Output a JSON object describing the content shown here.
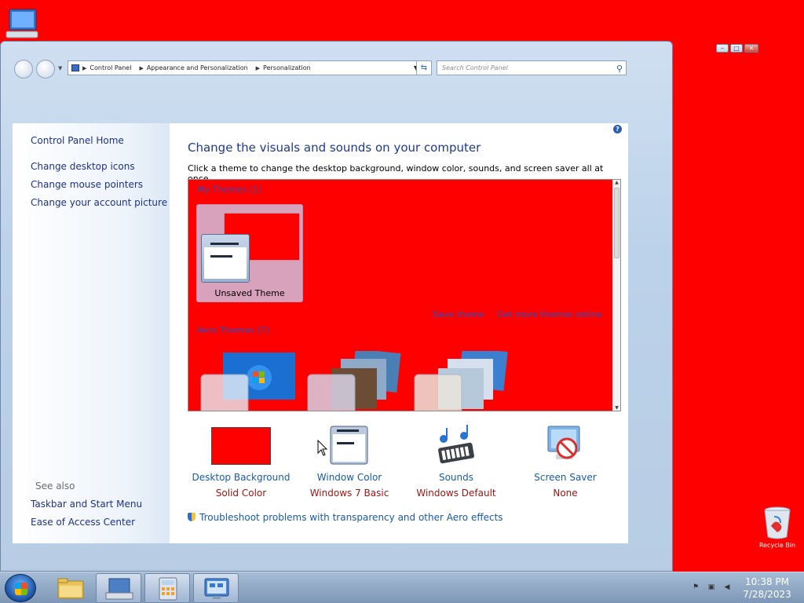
{
  "desktop": {
    "recycle_bin_label": "Recycle Bin"
  },
  "window": {
    "address": {
      "crumbs": [
        "Control Panel",
        "Appearance and Personalization",
        "Personalization"
      ]
    },
    "search_placeholder": "Search Control Panel",
    "caption": {
      "minimize": "–",
      "maximize": "□",
      "close": "✕"
    }
  },
  "sidebar": {
    "home": "Control Panel Home",
    "links": [
      "Change desktop icons",
      "Change mouse pointers",
      "Change your account picture"
    ],
    "see_also": "See also",
    "see_also_links": [
      "Taskbar and Start Menu",
      "Ease of Access Center"
    ]
  },
  "main": {
    "title": "Change the visuals and sounds on your computer",
    "subtitle": "Click a theme to change the desktop background, window color, sounds, and screen saver all at once.",
    "themes": {
      "my_themes_label": "My Themes (1)",
      "unsaved_theme": "Unsaved Theme",
      "save_theme": "Save theme",
      "get_more": "Get more themes online",
      "aero_label": "Aero Themes (7)"
    },
    "settings": [
      {
        "name": "Desktop Background",
        "value": "Solid Color",
        "icon": "desktop-background-icon"
      },
      {
        "name": "Window Color",
        "value": "Windows 7 Basic",
        "icon": "window-color-icon"
      },
      {
        "name": "Sounds",
        "value": "Windows Default",
        "icon": "sounds-icon"
      },
      {
        "name": "Screen Saver",
        "value": "None",
        "icon": "screen-saver-icon"
      }
    ],
    "troubleshoot": "Troubleshoot problems with transparency and other Aero effects"
  },
  "taskbar": {
    "time": "10:38 PM",
    "date": "7/28/2023"
  },
  "colors": {
    "desktop": "#ff0000",
    "link": "#1e3287",
    "value": "#a01515"
  }
}
